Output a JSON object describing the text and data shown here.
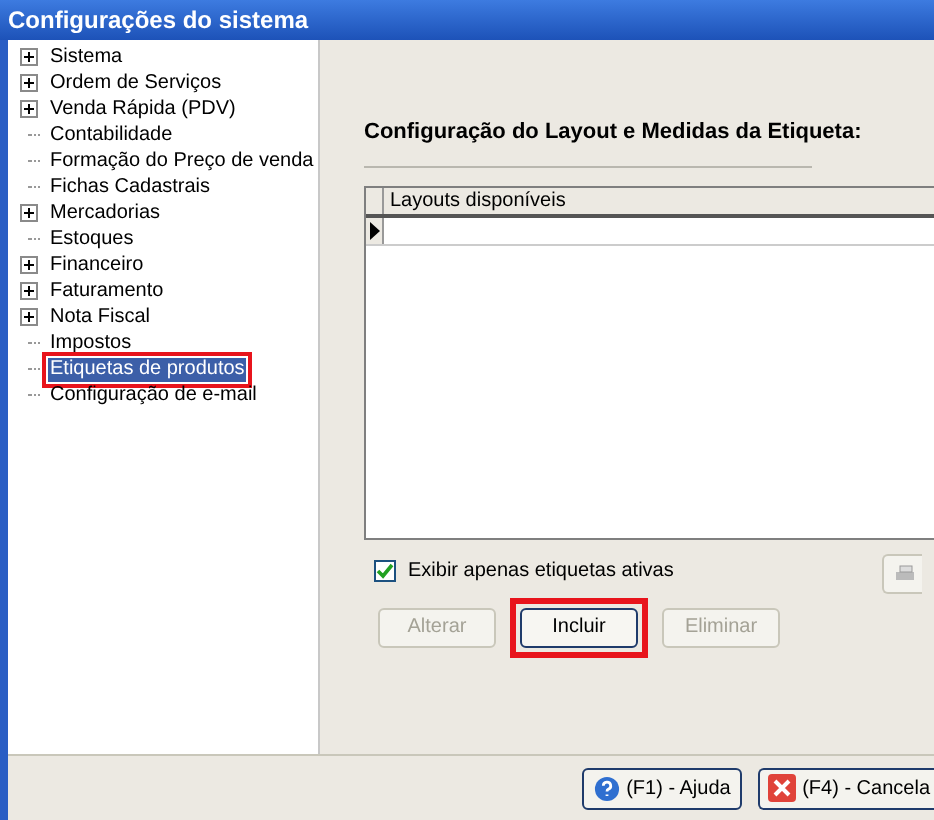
{
  "window": {
    "title": "Configurações do sistema"
  },
  "tree": [
    {
      "label": "Sistema",
      "expandable": true,
      "selected": false,
      "marked": false
    },
    {
      "label": "Ordem de Serviços",
      "expandable": true,
      "selected": false,
      "marked": false
    },
    {
      "label": "Venda Rápida (PDV)",
      "expandable": true,
      "selected": false,
      "marked": false
    },
    {
      "label": "Contabilidade",
      "expandable": false,
      "selected": false,
      "marked": false
    },
    {
      "label": "Formação do Preço de venda",
      "expandable": false,
      "selected": false,
      "marked": false
    },
    {
      "label": "Fichas Cadastrais",
      "expandable": false,
      "selected": false,
      "marked": false
    },
    {
      "label": "Mercadorias",
      "expandable": true,
      "selected": false,
      "marked": false
    },
    {
      "label": "Estoques",
      "expandable": false,
      "selected": false,
      "marked": false
    },
    {
      "label": "Financeiro",
      "expandable": true,
      "selected": false,
      "marked": false
    },
    {
      "label": "Faturamento",
      "expandable": true,
      "selected": false,
      "marked": false
    },
    {
      "label": "Nota Fiscal",
      "expandable": true,
      "selected": false,
      "marked": false
    },
    {
      "label": "Impostos",
      "expandable": false,
      "selected": false,
      "marked": false
    },
    {
      "label": "Etiquetas de produtos",
      "expandable": false,
      "selected": true,
      "marked": true
    },
    {
      "label": "Configuração de e-mail",
      "expandable": false,
      "selected": false,
      "marked": false
    }
  ],
  "heading": "Configuração do Layout e Medidas da Etiqueta:",
  "table": {
    "columns": [
      "Layouts disponíveis"
    ]
  },
  "active_only": {
    "label": "Exibir apenas etiquetas ativas",
    "checked": true
  },
  "actions": [
    {
      "label": "Alterar",
      "disabled": true,
      "marked": false
    },
    {
      "label": "Incluir",
      "disabled": false,
      "marked": true
    },
    {
      "label": "Eliminar",
      "disabled": true,
      "marked": false
    }
  ],
  "footer_buttons": [
    {
      "label": "(F1) - Ajuda",
      "kind": "help"
    },
    {
      "label": "(F4) - Cancela",
      "kind": "cancel"
    }
  ]
}
